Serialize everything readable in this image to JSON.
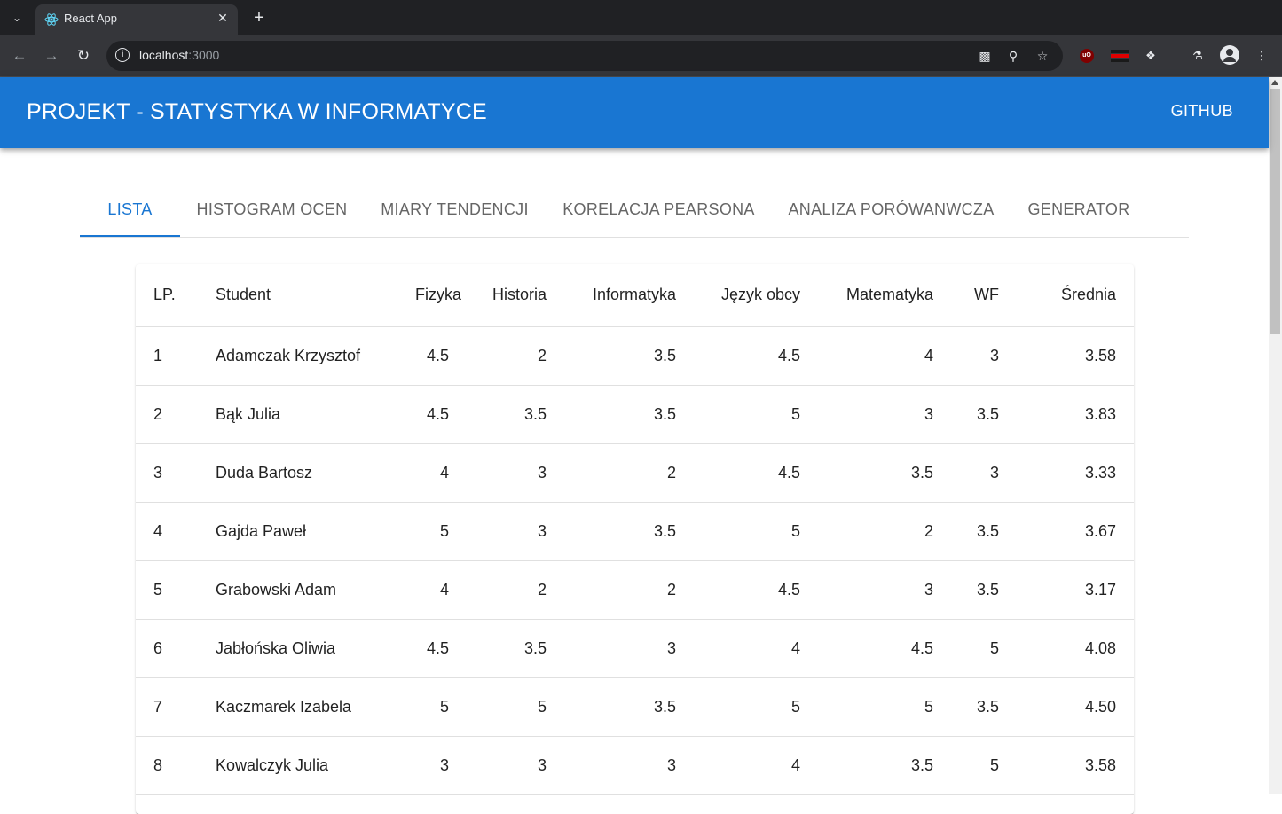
{
  "browser": {
    "tab_title": "React App",
    "url_host": "localhost",
    "url_port": ":3000"
  },
  "colors": {
    "appbar": "#1976d2",
    "accent": "#1976d2"
  },
  "appbar": {
    "title": "PROJEKT - STATYSTYKA W INFORMATYCE",
    "github_label": "GITHUB"
  },
  "tabs": [
    {
      "label": "LISTA",
      "selected": true
    },
    {
      "label": "HISTOGRAM OCEN",
      "selected": false
    },
    {
      "label": "MIARY TENDENCJI",
      "selected": false
    },
    {
      "label": "KORELACJA PEARSONA",
      "selected": false
    },
    {
      "label": "ANALIZA PORÓWANWCZA",
      "selected": false
    },
    {
      "label": "GENERATOR",
      "selected": false
    }
  ],
  "table": {
    "headers": [
      "LP.",
      "Student",
      "Fizyka",
      "Historia",
      "Informatyka",
      "Język obcy",
      "Matematyka",
      "WF",
      "Średnia"
    ],
    "rows": [
      [
        "1",
        "Adamczak Krzysztof",
        "4.5",
        "2",
        "3.5",
        "4.5",
        "4",
        "3",
        "3.58"
      ],
      [
        "2",
        "Bąk Julia",
        "4.5",
        "3.5",
        "3.5",
        "5",
        "3",
        "3.5",
        "3.83"
      ],
      [
        "3",
        "Duda Bartosz",
        "4",
        "3",
        "2",
        "4.5",
        "3.5",
        "3",
        "3.33"
      ],
      [
        "4",
        "Gajda Paweł",
        "5",
        "3",
        "3.5",
        "5",
        "2",
        "3.5",
        "3.67"
      ],
      [
        "5",
        "Grabowski Adam",
        "4",
        "2",
        "2",
        "4.5",
        "3",
        "3.5",
        "3.17"
      ],
      [
        "6",
        "Jabłońska Oliwia",
        "4.5",
        "3.5",
        "3",
        "4",
        "4.5",
        "5",
        "4.08"
      ],
      [
        "7",
        "Kaczmarek Izabela",
        "5",
        "5",
        "3.5",
        "5",
        "5",
        "3.5",
        "4.50"
      ],
      [
        "8",
        "Kowalczyk Julia",
        "3",
        "3",
        "3",
        "4",
        "3.5",
        "5",
        "3.58"
      ]
    ]
  }
}
